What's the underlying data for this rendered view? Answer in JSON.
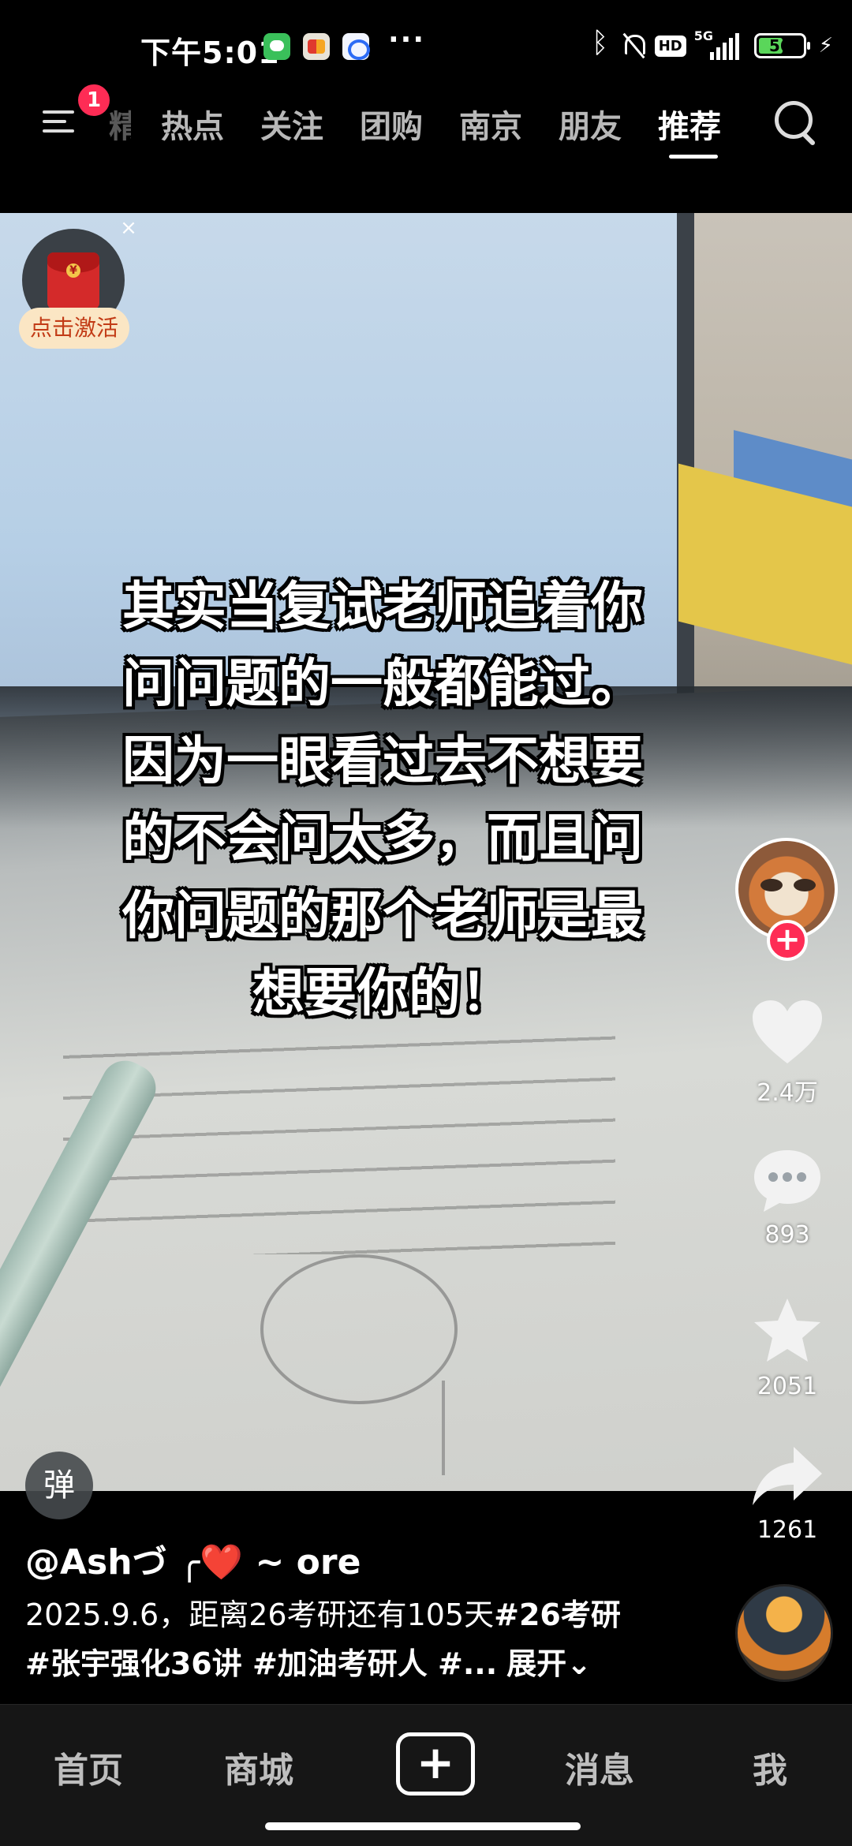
{
  "status_bar": {
    "time": "下午5:01",
    "more": "···",
    "hd": "HD",
    "network": "5G",
    "battery": "56",
    "battery_level": 0.56,
    "app_icons": [
      "wechat-icon",
      "58-app-icon",
      "baidu-netdisk-icon"
    ]
  },
  "top_nav": {
    "menu_badge": "1",
    "partial_tab": "精选",
    "tabs": [
      "热点",
      "关注",
      "团购",
      "南京",
      "朋友",
      "推荐"
    ],
    "active_tab": "推荐"
  },
  "red_packet": {
    "label": "点击激活",
    "close": "×"
  },
  "caption": {
    "lines": [
      "其实当复试老师追着你",
      "问问题的一般都能过。",
      "因为一眼看过去不想要",
      "的不会问太多，而且问",
      "你问题的那个老师是最",
      "想要你的！"
    ]
  },
  "rail": {
    "follow": "+",
    "likes": "2.4万",
    "comments": "893",
    "favorites": "2051",
    "shares": "1261"
  },
  "danmaku": "弹",
  "info": {
    "author": "@Ashづ ╭❤️ ~ ore",
    "desc_line1_text": "2025.9.6，距离26考研还有105天",
    "desc_line1_tag": "#26考研",
    "desc_line2_tags": "#张宇强化36讲 #加油考研人 #...",
    "expand": "展开⌄"
  },
  "bottom_nav": {
    "home": "首页",
    "mall": "商城",
    "create": "+",
    "messages": "消息",
    "me": "我"
  },
  "colors": {
    "accent": "#fe2c55",
    "background": "#000000",
    "red_packet_label_bg": "#fbe6c4",
    "red_packet_label_text": "#c23b16"
  }
}
